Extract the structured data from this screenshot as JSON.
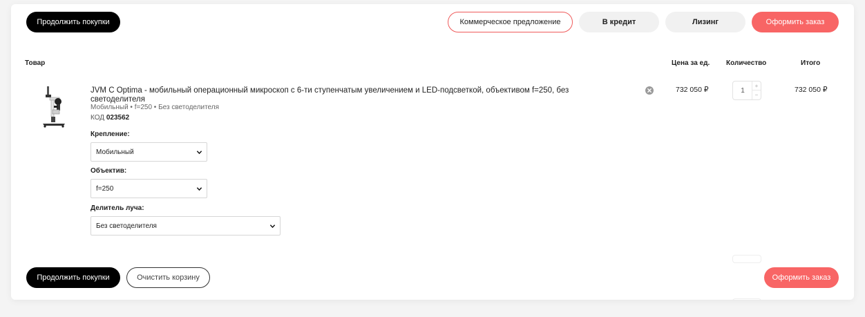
{
  "top_buttons": {
    "continue": "Продолжить покупки",
    "commercial_offer": "Коммерческое предложение",
    "credit": "В кредит",
    "leasing": "Лизинг",
    "checkout": "Оформить заказ"
  },
  "table_headers": {
    "product": "Товар",
    "unit_price": "Цена за ед.",
    "quantity": "Количество",
    "total": "Итого"
  },
  "product": {
    "title": "JVM C Optima - мобильный операционный микроскоп с 6-ти ступенчатым увеличением и LED-подсветкой, объективом f=250, без светоделителя",
    "variant": "Мобильный • f=250 • Без светоделителя",
    "code_label": "КОД",
    "code": "023562",
    "price": "732 050 ₽",
    "quantity": "1",
    "total": "732 050 ₽",
    "image_icon": "microscope-icon",
    "options": [
      {
        "label": "Крепление:",
        "value": "Мобильный"
      },
      {
        "label": "Объектив:",
        "value": "f=250"
      },
      {
        "label": "Делитель луча:",
        "value": "Без светоделителя"
      }
    ]
  },
  "bottom_buttons": {
    "continue": "Продолжить покупки",
    "clear": "Очистить корзину",
    "checkout": "Оформить заказ"
  },
  "colors": {
    "accent_red": "#f86565",
    "black": "#000000"
  }
}
